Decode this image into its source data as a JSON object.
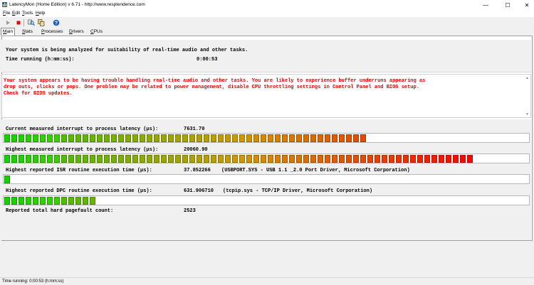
{
  "window": {
    "title": "LatencyMon  (Home Edition)  v 6.71 - http://www.resplendence.com",
    "minimize_glyph": "—",
    "maximize_glyph": "☐",
    "close_glyph": "✕"
  },
  "menu": [
    {
      "u": "F",
      "rest": "ile"
    },
    {
      "u": "E",
      "rest": "dit"
    },
    {
      "u": "T",
      "rest": "ools"
    },
    {
      "u": "H",
      "rest": "elp"
    }
  ],
  "toolbar": {
    "icons": [
      "play-icon",
      "stop-icon",
      "magnifier-icon",
      "copy-icon",
      "help-icon"
    ]
  },
  "tabs": [
    {
      "u": "M",
      "rest": "ain",
      "active": true
    },
    {
      "u": "S",
      "rest": "tats",
      "active": false
    },
    {
      "u": "P",
      "rest": "rocesses",
      "active": false
    },
    {
      "u": "D",
      "rest": "rivers",
      "active": false
    },
    {
      "u": "C",
      "rest": "PUs",
      "active": false
    }
  ],
  "status": {
    "line": "Your system is being analyzed for suitability of real-time audio and other tasks.",
    "time_label": "Time running (h:mm:ss):",
    "time_value": "0:00:53"
  },
  "warning": {
    "lines": [
      "Your system appears to be having trouble handling real-time audio and other tasks. You are likely to experience buffer underruns appearing as",
      "drop outs, clicks or pops. One problem may be related to power management, disable CPU throttling settings in Control Panel and BIOS setup.",
      "Check for BIOS updates."
    ],
    "color": "#e00000"
  },
  "metrics": [
    {
      "label": "Current measured interrupt to process latency (µs):",
      "value": "7631.70",
      "detail": "",
      "bar_segments": 51
    },
    {
      "label": "Highest measured interrupt to process latency (µs):",
      "value": "20060.90",
      "detail": "",
      "bar_segments": 66
    },
    {
      "label": "Highest reported ISR routine execution time (µs):",
      "value": "37.852266",
      "detail": "(USBPORT.SYS - USB 1.1 _2.0 Port Driver, Microsoft Corporation)",
      "bar_segments": 1
    },
    {
      "label": "Highest reported DPC routine execution time (µs):",
      "value": "631.906710",
      "detail": "(tcpip.sys - TCP/IP Driver, Microsoft Corporation)",
      "bar_segments": 13
    },
    {
      "label": "Reported total hard pagefault count:",
      "value": "2523",
      "detail": "",
      "bar_segments": 0
    }
  ],
  "statusbar": {
    "text": "Time running: 0:00:53  (h:mm:ss)"
  }
}
